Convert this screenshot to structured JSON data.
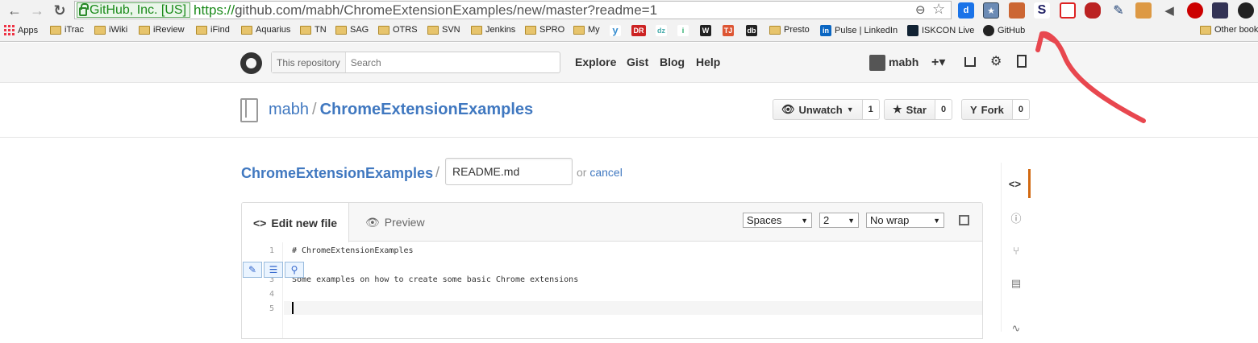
{
  "browser": {
    "ev_badge": "GitHub, Inc. [US]",
    "url_scheme": "https://",
    "url_rest": "github.com/mabh/ChromeExtensionExamples/new/master?readme=1",
    "bookmarks": [
      "Apps",
      "iTrac",
      "iWiki",
      "iReview",
      "iFind",
      "Aquarius",
      "TN",
      "SAG",
      "OTRS",
      "SVN",
      "Jenkins",
      "SPRO",
      "My",
      "Presto",
      "Pulse | LinkedIn",
      "ISKCON Live",
      "GitHub",
      "Other book"
    ]
  },
  "header": {
    "search_scope": "This repository",
    "search_placeholder": "Search",
    "nav": [
      "Explore",
      "Gist",
      "Blog",
      "Help"
    ],
    "username": "mabh",
    "plus": "+▾"
  },
  "repo": {
    "owner": "mabh",
    "separator": "/",
    "name": "ChromeExtensionExamples",
    "watch_label": "Unwatch",
    "watch_count": "1",
    "star_label": "Star",
    "star_count": "0",
    "fork_label": "Fork",
    "fork_count": "0"
  },
  "breadcrumb": {
    "repo": "ChromeExtensionExamples",
    "sep": "/",
    "filename": "README.md",
    "or": "or",
    "cancel": "cancel"
  },
  "editor": {
    "tab_edit": "Edit new file",
    "tab_preview": "Preview",
    "indent_mode": "Spaces",
    "indent_size": "2",
    "wrap_mode": "No wrap",
    "line_numbers": [
      "1",
      "2",
      "3",
      "4",
      "5"
    ],
    "lines": [
      "# ChromeExtensionExamples",
      "",
      "Some examples on how to create some basic Chrome extensions",
      "",
      ""
    ]
  },
  "colors": {
    "link": "#4078c0",
    "annotation_arrow": "#e8474f"
  }
}
